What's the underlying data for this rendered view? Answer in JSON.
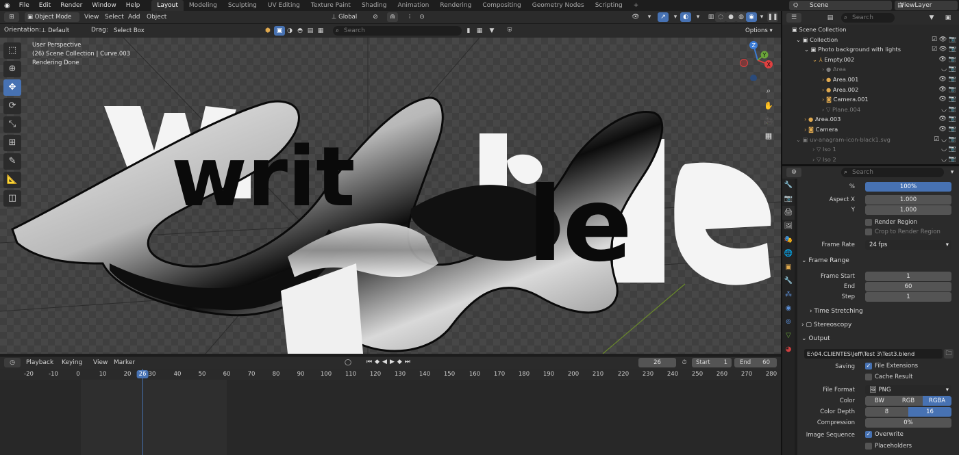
{
  "topbar": {
    "menus": [
      "File",
      "Edit",
      "Render",
      "Window",
      "Help"
    ],
    "workspaces": [
      "Layout",
      "Modeling",
      "Sculpting",
      "UV Editing",
      "Texture Paint",
      "Shading",
      "Animation",
      "Rendering",
      "Compositing",
      "Geometry Nodes",
      "Scripting"
    ],
    "add_tab": "+",
    "scene_name": "Scene",
    "view_layer": "ViewLayer"
  },
  "viewport_header": {
    "mode": "Object Mode",
    "menus": [
      "View",
      "Select",
      "Add",
      "Object"
    ],
    "transform_orientation": "Global",
    "orientation_label": "Orientation:",
    "orientation_value": "Default",
    "drag_label": "Drag:",
    "drag_value": "Select Box",
    "search_placeholder": "Search",
    "options_label": "Options"
  },
  "viewport_info": {
    "line1": "User Perspective",
    "line2": "(26) Scene Collection | Curve.003",
    "line3": "Rendering Done"
  },
  "render": {
    "word_left": "writ",
    "word_right": "le",
    "colors": {
      "background": "#3d3d3d",
      "chrome_dark": "#101010",
      "white": "#f4f4f4"
    }
  },
  "gizmo": {
    "x": "X",
    "y": "Y",
    "z": "Z"
  },
  "timeline": {
    "menus": [
      "Playback",
      "Keying",
      "View",
      "Marker"
    ],
    "current_frame": "26",
    "start_label": "Start",
    "start_value": "1",
    "end_label": "End",
    "end_value": "60",
    "ticks": [
      "-20",
      "-10",
      "0",
      "10",
      "20",
      "26",
      "30",
      "40",
      "50",
      "60",
      "70",
      "80",
      "90",
      "100",
      "110",
      "120",
      "130",
      "140",
      "150",
      "160",
      "170",
      "180",
      "190",
      "200",
      "210",
      "220",
      "230",
      "240",
      "250",
      "260",
      "270",
      "280"
    ]
  },
  "outliner": {
    "search_placeholder": "Search",
    "rows": [
      {
        "label": "Scene Collection",
        "dim": false
      },
      {
        "label": "Collection",
        "dim": false
      },
      {
        "label": "Photo background with lights",
        "dim": false
      },
      {
        "label": "Empty.002",
        "dim": false
      },
      {
        "label": "Area",
        "dim": true
      },
      {
        "label": "Area.001",
        "dim": false
      },
      {
        "label": "Area.002",
        "dim": false
      },
      {
        "label": "Camera.001",
        "dim": false
      },
      {
        "label": "Plane.004",
        "dim": true
      },
      {
        "label": "Area.003",
        "dim": false
      },
      {
        "label": "Camera",
        "dim": false
      },
      {
        "label": "uv-anagram-icon-black1.svg",
        "dim": true
      },
      {
        "label": "Iso 1",
        "dim": true
      },
      {
        "label": "Iso 2",
        "dim": true
      }
    ]
  },
  "properties": {
    "search_placeholder": "Search",
    "percent_label": "%",
    "percent_value": "100%",
    "aspect_x_label": "Aspect X",
    "aspect_x": "1.000",
    "aspect_y_label": "Y",
    "aspect_y": "1.000",
    "render_region": "Render Region",
    "crop_region": "Crop to Render Region",
    "frame_rate_label": "Frame Rate",
    "frame_rate": "24 fps",
    "frame_range_title": "Frame Range",
    "frame_start_label": "Frame Start",
    "frame_start": "1",
    "end_label": "End",
    "end": "60",
    "step_label": "Step",
    "step": "1",
    "time_stretching": "Time Stretching",
    "stereoscopy": "Stereoscopy",
    "output_title": "Output",
    "output_path": "E:\\04.CLIENTES\\Jeff\\Test 3\\Test3.blend",
    "saving_label": "Saving",
    "file_extensions": "File Extensions",
    "cache_result": "Cache Result",
    "file_format_label": "File Format",
    "file_format": "PNG",
    "color_label": "Color",
    "color_options": [
      "BW",
      "RGB",
      "RGBA"
    ],
    "color_depth_label": "Color Depth",
    "color_depth_options": [
      "8",
      "16"
    ],
    "compression_label": "Compression",
    "compression": "0%",
    "image_sequence_label": "Image Sequence",
    "overwrite": "Overwrite",
    "placeholders": "Placeholders"
  }
}
